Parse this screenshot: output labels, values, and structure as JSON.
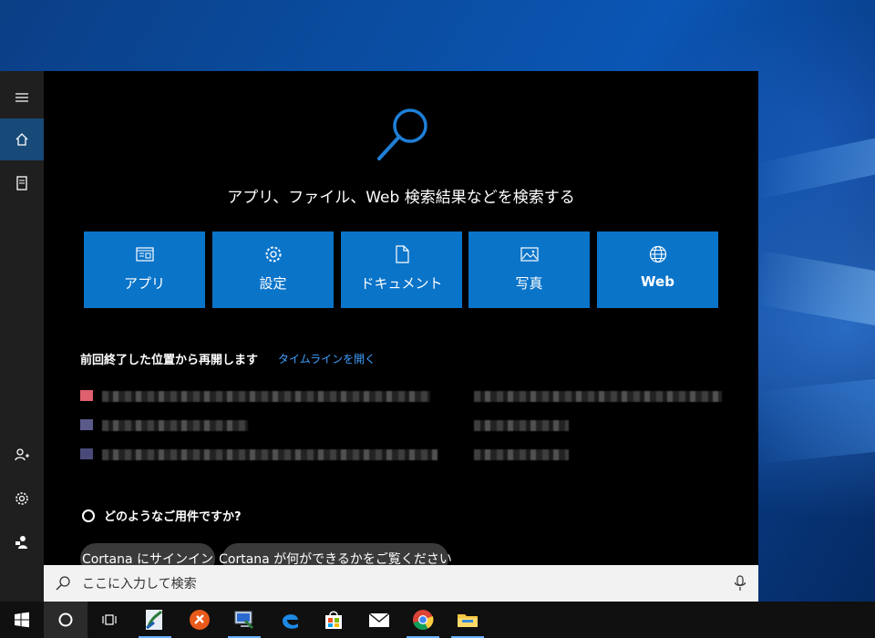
{
  "search_panel": {
    "heading": "アプリ、ファイル、Web 検索結果などを検索する",
    "categories": [
      {
        "label": "アプリ",
        "icon": "app-window-icon"
      },
      {
        "label": "設定",
        "icon": "gear-icon"
      },
      {
        "label": "ドキュメント",
        "icon": "document-icon"
      },
      {
        "label": "写真",
        "icon": "image-icon"
      },
      {
        "label": "Web",
        "icon": "globe-icon"
      }
    ],
    "resume_title": "前回終了した位置から再開します",
    "timeline_link": "タイムラインを開く",
    "cortana_prompt": "どのようなご用件ですか?",
    "cortana_chips": [
      "Cortana にサインイン",
      "Cortana が何ができるかをご覧ください"
    ],
    "search_placeholder": "ここに入力して検索"
  },
  "sidebar": {
    "items": [
      "hamburger-menu-icon",
      "home-icon",
      "notebook-icon",
      "add-person-icon",
      "gear-icon",
      "feedback-icon"
    ],
    "active_item": "home-icon"
  },
  "taskbar": {
    "items": [
      "windows-start-icon",
      "cortana-circle-icon",
      "task-view-icon",
      "app-icon-1",
      "app-icon-2",
      "app-icon-3",
      "edge-browser-icon",
      "store-icon",
      "mail-icon",
      "chrome-icon",
      "file-explorer-icon"
    ]
  },
  "colors": {
    "accent": "#0a74c9",
    "link": "#3fa0ff",
    "panel_bg": "#000000",
    "rail_bg": "#1f1f1f"
  }
}
